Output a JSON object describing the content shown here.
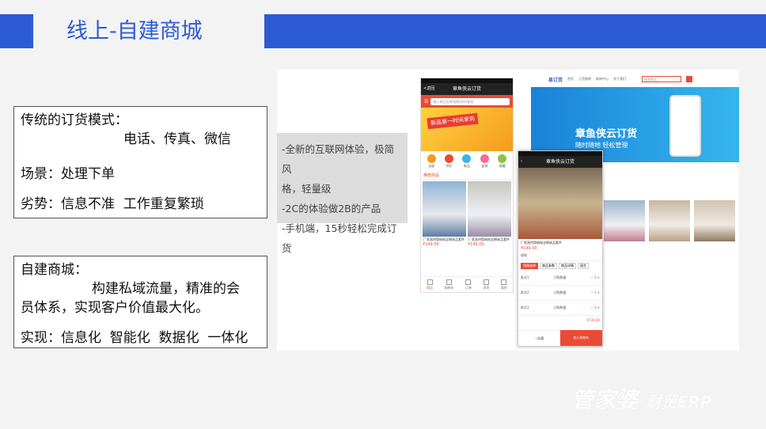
{
  "title": "线上-自建商城",
  "box1": {
    "line1": "传统的订货模式：",
    "line2": "电话、传真、微信",
    "line3": "场景：处理下单",
    "line4": "劣势：信息不准  工作重复繁琐"
  },
  "box2": {
    "line1": "自建商城：",
    "line2": "构建私域流量，精准的会",
    "line3": "员体系，实现客户价值最大化。",
    "line4": "实现：信息化  智能化  数据化  一体化"
  },
  "panel": {
    "line1": "-全新的互联网体验，极简风",
    "line2": "格，轻量级",
    "line3": "-2C的体验做2B的产品",
    "line4": "-手机端，15秒轻松完成订货"
  },
  "phone1": {
    "back": "<返回",
    "title": "章鱼侠云订货",
    "search": "输入商品名称/规格/条码查找",
    "banner": "新品第一时间享到",
    "icons": [
      "全部",
      "特价",
      "新品",
      "促销",
      "收藏"
    ],
    "icon_colors": [
      "#f39b1f",
      "#e94b35",
      "#3bb3e8",
      "#f56c9b",
      "#8bc34a"
    ],
    "recommend": "推荐商品",
    "products": [
      {
        "name": "厂家直供简纳纯全棉床品套件",
        "price": "¥149.00"
      },
      {
        "name": "厂家直供简纳纯全棉床品套件",
        "price": "¥149.00"
      }
    ],
    "tabs": [
      "商品",
      "购物车",
      "订单",
      "消息",
      "我的"
    ]
  },
  "site": {
    "logo": "易订货",
    "nav": [
      "首页",
      "订货指南",
      "新闻中心",
      "关于我们"
    ],
    "search": "搜索商品",
    "banner_title": "章鱼侠云订货",
    "banner_sub": "随时随地 轻松管理"
  },
  "phone2": {
    "title": "章鱼侠云订货",
    "name": "厂家直供简纳纯全棉床品套件",
    "price": "¥149.00",
    "spec": "规格",
    "tabs": [
      "规格选择",
      "商品参数",
      "商品详情",
      "留言"
    ],
    "lines": [
      "款式1",
      "款式2",
      "款式3"
    ],
    "qty": "订购数量",
    "total": "¥730.00",
    "fav": "☆收藏",
    "cart": "加入购物车"
  },
  "watermark": "管家婆",
  "watermark_sub": "财贸ERP"
}
